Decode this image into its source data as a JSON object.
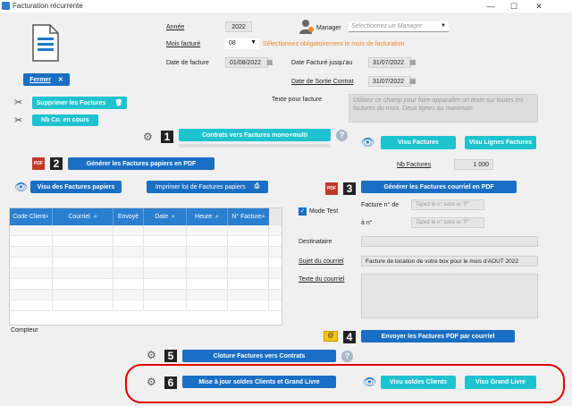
{
  "window": {
    "title": "Facturation récurrente",
    "minimize": "—",
    "maximize": "☐",
    "close": "✕"
  },
  "fermer": {
    "label": "Fermer",
    "icon": "close-icon"
  },
  "form": {
    "annee_label": "Année",
    "annee_value": "2022",
    "mois_label": "Mois facturé",
    "mois_value": "08",
    "mois_warning": "Sélectionnez obligatoirement le mois de facturation",
    "date_facture_label": "Date de facture",
    "date_facture_value": "01/08/2022",
    "date_jusquau_label": "Date Facturé jusqu'au",
    "date_jusquau_value": "31/07/2022",
    "date_sortie_label": "Date de Sortie Contrat",
    "date_sortie_value": "31/07/2022",
    "manager_label": "Manager",
    "manager_placeholder": "Sélectionnez un Manager",
    "texte_facture_label": "Texte pour facture",
    "texte_facture_placeholder": "Utilisez ce champ pour faire apparaître un texte sur toutes les factures du mois. Deux lignes au maximum",
    "nb_factures_label": "Nb Factures",
    "nb_factures_value": "1 000"
  },
  "tools": {
    "supprimer": "Supprimer les Factures",
    "nbco": "Nb Co. en cours"
  },
  "steps": {
    "s1": {
      "num": "1",
      "label": "Contrats vers Factures mono+multi",
      "help": "?"
    },
    "s2": {
      "num": "2",
      "label": "Générer les Factures papiers en PDF"
    },
    "s3": {
      "num": "3",
      "label": "Générer les Factures courriel en PDF"
    },
    "s4": {
      "num": "4",
      "label": "Envoyer les Factures PDF par courriel"
    },
    "s5": {
      "num": "5",
      "label": "Cloture Factures vers Contrats",
      "help": "?"
    },
    "s6": {
      "num": "6",
      "label": "Mise à jour soldes Clients et Grand Livre"
    }
  },
  "visu": {
    "factures": "Visu Factures",
    "lignes": "Visu Lignes Factures",
    "papiers": "Visu des Factures papiers",
    "imprimer": "Imprimer lot de Factures papiers",
    "soldes": "Visu soldes Clients",
    "grand_livre": "Visu Grand Livre"
  },
  "table": {
    "columns": [
      "Code Client",
      "Courriel",
      "Envoyé",
      "Date",
      "Heure",
      "N° Facture"
    ],
    "compteur": "Compteur"
  },
  "email": {
    "mode_test": "Mode Test",
    "facture_no_label": "Facture n° de",
    "facture_no_placeholder": "Tapez le n° sans le \"F\"",
    "a_no_label": "à n°",
    "a_no_placeholder": "Tapez le n° sans le \"F\"",
    "destinataire_label": "Destinataire",
    "sujet_label": "Sujet du courriel",
    "sujet_value": "Facture de location de votre box pour le mois d'AOUT 2022",
    "texte_label": "Texte du courriel"
  },
  "colors": {
    "accent": "#2aa9e0",
    "teal": "#1ec3cf",
    "warning": "#e8862a",
    "highlight": "#e10000"
  }
}
